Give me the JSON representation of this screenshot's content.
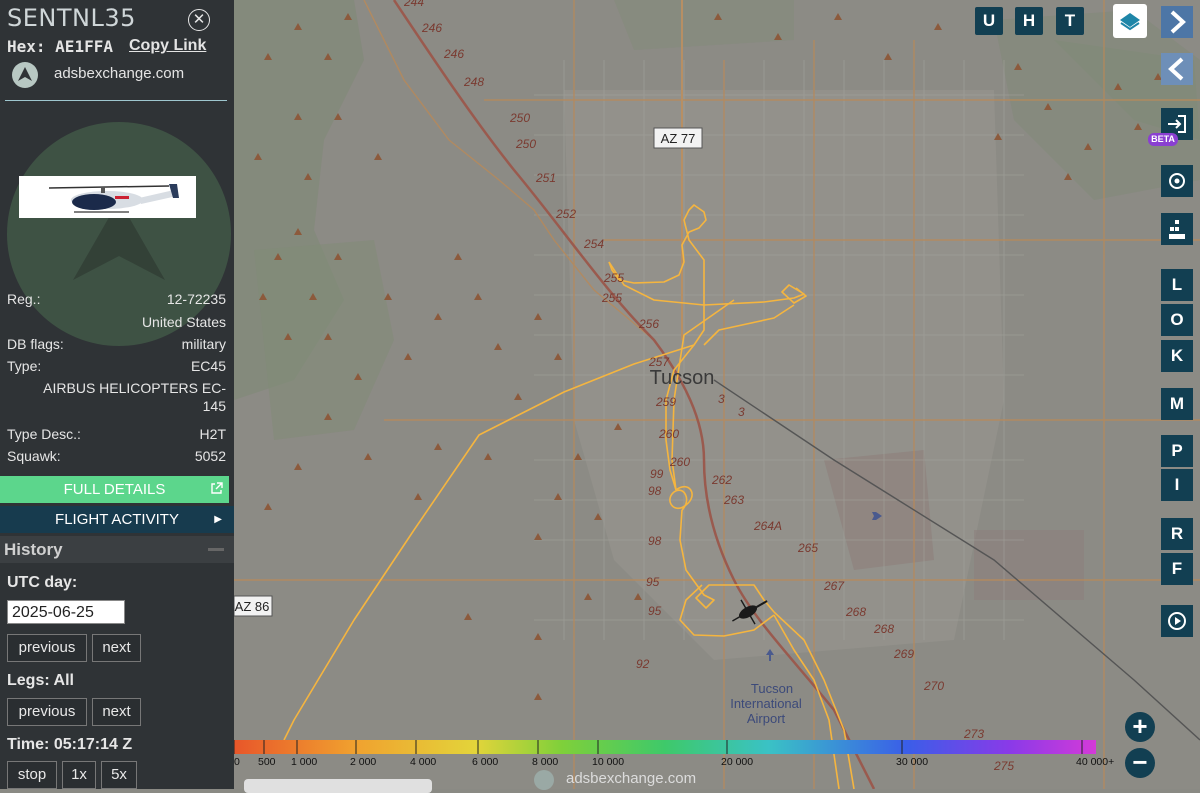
{
  "aircraft": {
    "callsign": "SENTNL35",
    "hex_label": "Hex:",
    "hex": "AE1FFA",
    "copy_link": "Copy Link",
    "source": "adsbexchange.com",
    "close_icon": "close-circle-icon"
  },
  "details": {
    "reg_label": "Reg.:",
    "reg": "12-72235",
    "country": "United States",
    "db_flags_label": "DB flags:",
    "db_flags": "military",
    "type_label": "Type:",
    "type": "EC45",
    "type_name_line1": "AIRBUS HELICOPTERS EC-",
    "type_name_line2": "145",
    "type_desc_label": "Type Desc.:",
    "type_desc": "H2T",
    "squawk_label": "Squawk:",
    "squawk": "5052"
  },
  "buttons": {
    "full_details": "FULL DETAILS",
    "flight_activity": "FLIGHT ACTIVITY"
  },
  "history": {
    "title": "History",
    "utc_day_label": "UTC day:",
    "date": "2025-06-25",
    "previous": "previous",
    "next": "next",
    "legs_label": "Legs: All",
    "time_label": "Time: 05:17:14 Z",
    "stop": "stop",
    "speed_1x": "1x",
    "speed_5x": "5x"
  },
  "map": {
    "buttons_top": [
      "U",
      "H",
      "T"
    ],
    "buttons_right": [
      "L",
      "O",
      "K",
      "M",
      "P",
      "I",
      "R",
      "F"
    ],
    "beta": "BETA",
    "city": "Tucson",
    "airport_line1": "Tucson",
    "airport_line2": "International",
    "airport_line3": "Airport",
    "road_az77": "AZ 77",
    "road_az86": "AZ 86",
    "mileposts": [
      "244",
      "246",
      "246",
      "248",
      "250",
      "250",
      "251",
      "252",
      "254",
      "255",
      "255",
      "256",
      "257",
      "259",
      "260",
      "260",
      "262",
      "263",
      "264A",
      "265",
      "267",
      "268",
      "268",
      "269",
      "270",
      "273",
      "275",
      "3",
      "3",
      "99",
      "98",
      "98",
      "95",
      "95",
      "92"
    ],
    "watermark": "adsbexchange.com",
    "track_color": "#f5b53f",
    "map_tint": "#8a8a84"
  },
  "altitude_legend": [
    "0",
    "500",
    "1 000",
    "2 000",
    "4 000",
    "6 000",
    "8 000",
    "10 000",
    "20 000",
    "30 000",
    "40 000+"
  ]
}
